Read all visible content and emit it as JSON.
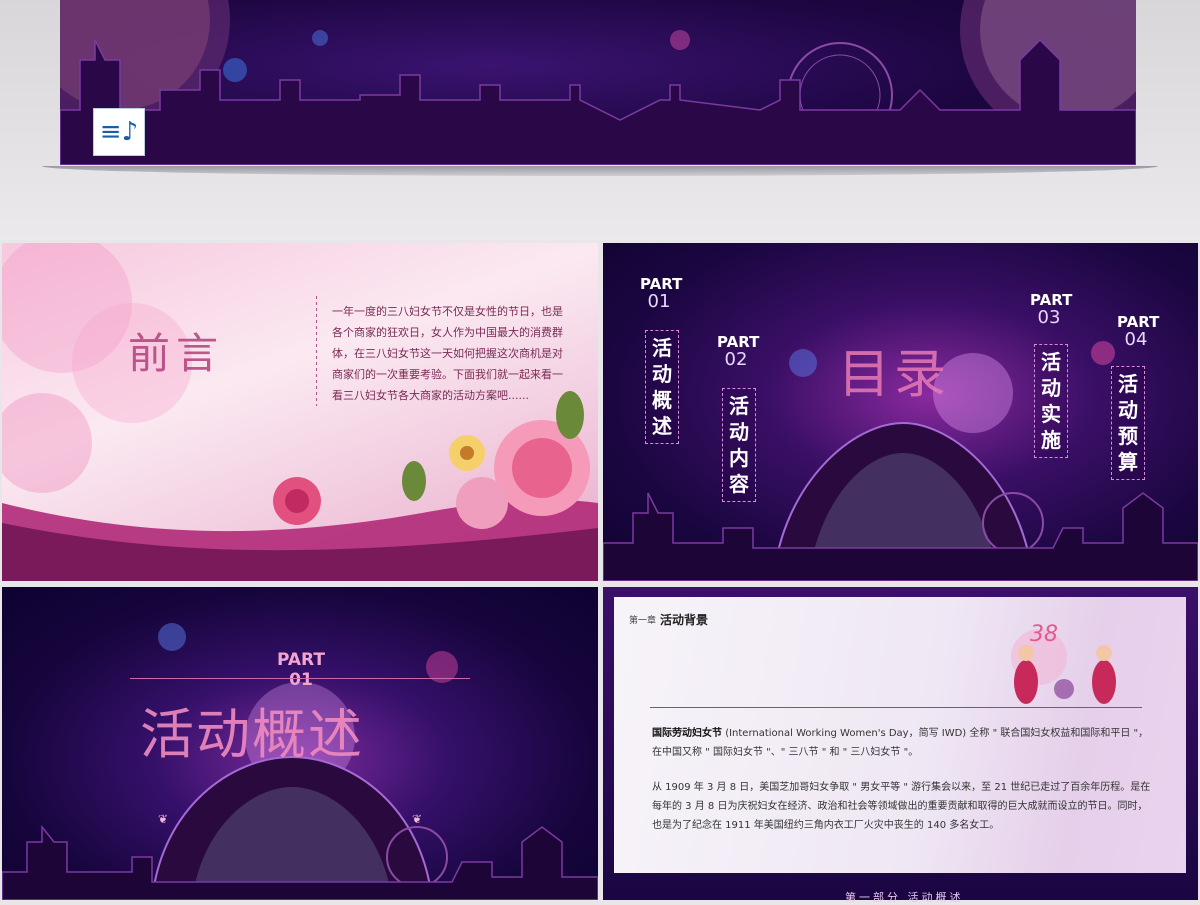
{
  "top": {
    "music_icon": "music-note-list-icon",
    "music_glyph": "≡♪"
  },
  "preface": {
    "title": "前言",
    "lines": [
      "一年一度的三八妇女节不仅是女性的节日，也是",
      "各个商家的狂欢日，女人作为中国最大的消费群",
      "体，在三八妇女节这一天如何把握这次商机是对",
      "商家们的一次重要考验。下面我们就一起来看一",
      "看三八妇女节各大商家的活动方案吧......"
    ]
  },
  "toc": {
    "title": "目录",
    "parts": [
      {
        "label": "PART",
        "num": "01",
        "text": "活动概述"
      },
      {
        "label": "PART",
        "num": "02",
        "text": "活动内容"
      },
      {
        "label": "PART",
        "num": "03",
        "text": "活动实施"
      },
      {
        "label": "PART",
        "num": "04",
        "text": "活动预算"
      }
    ]
  },
  "part1": {
    "label": "PART 01",
    "title": "活动概述",
    "ornament": "❦"
  },
  "background": {
    "chapter": "第一章",
    "heading": "活动背景",
    "logo": "38",
    "para1_bold": "国际劳动妇女节",
    "para1_rest": "(International Working Women's Day，简写 IWD) 全称 \" 联合国妇女权益和国际和平日 \"，在中国又称 \" 国际妇女节 \"、\" 三八节 \" 和 \" 三八妇女节 \"。",
    "para2": "从 1909 年 3 月 8 日，美国芝加哥妇女争取 \" 男女平等 \" 游行集会以来，至 21 世纪已走过了百余年历程。是在每年的 3 月 8 日为庆祝妇女在经济、政治和社会等领域做出的重要贡献和取得的巨大成就而设立的节日。同时，也是为了纪念在 1911 年美国纽约三角内衣工厂火灾中丧生的 140 多名女工。",
    "footer": "第一部分 活动概述"
  },
  "colors": {
    "accent_pink": "#e77bb6",
    "deep_purple": "#1a0640",
    "preface_text": "#7a2a55"
  }
}
